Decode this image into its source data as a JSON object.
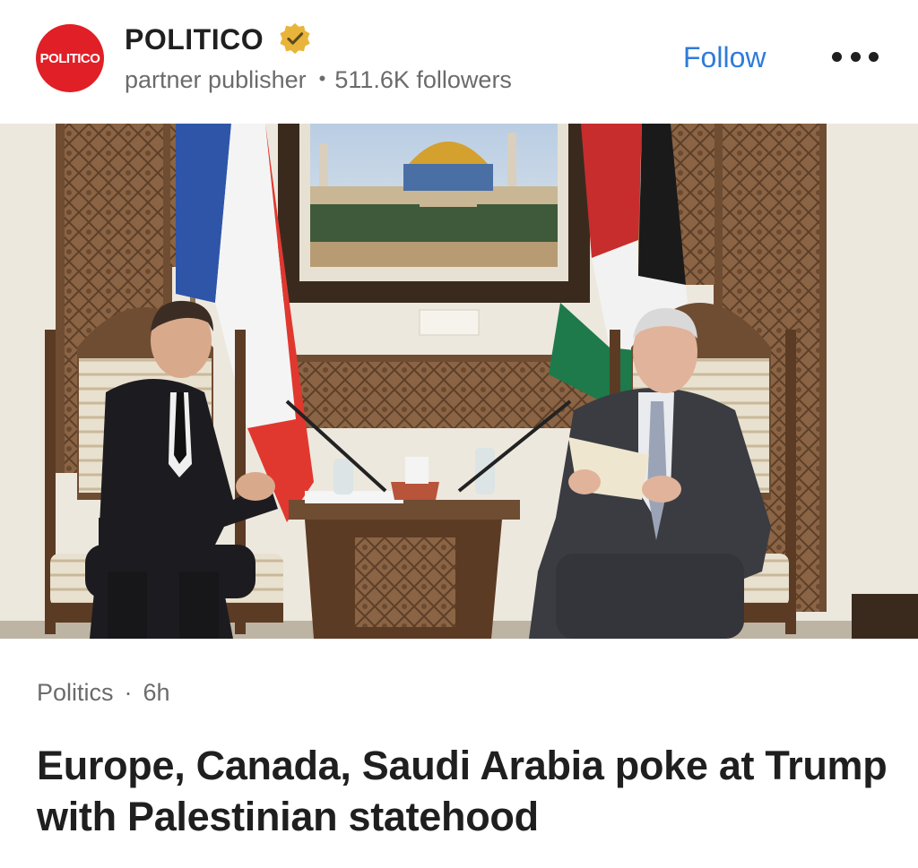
{
  "post": {
    "publisher": {
      "logo_text": "POLITICO",
      "name": "POLITICO",
      "role": "partner publisher",
      "followers": "511.6K followers"
    },
    "follow_label": "Follow",
    "more_icon": "more-horizontal-icon",
    "verified_icon": "verified-badge-icon",
    "category": "Politics",
    "separator": "·",
    "age": "6h",
    "headline": "Europe, Canada, Saudi Arabia poke at Trump with Palestinian statehood"
  },
  "colors": {
    "logo_red": "#e11f26",
    "follow_blue": "#2f7bd9",
    "verified_gold": "#e8b53a",
    "text_dark": "#1f1f1f",
    "text_muted": "#6b6b6b"
  }
}
